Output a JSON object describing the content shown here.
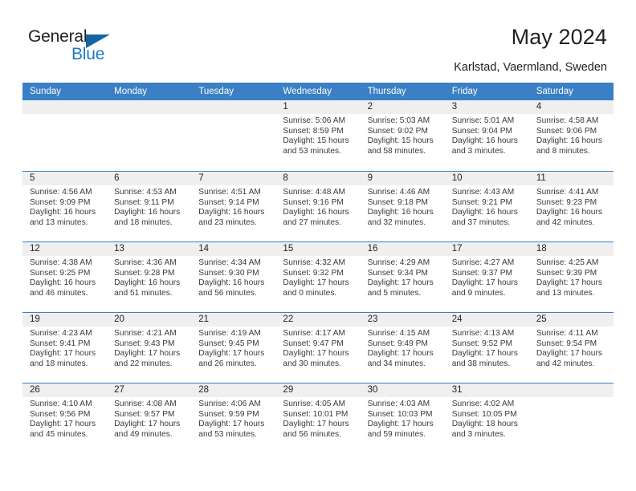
{
  "brand": {
    "name_part1": "General",
    "name_part2": "Blue",
    "accent_color": "#1f7ac0",
    "triangle_color": "#1464a5"
  },
  "header": {
    "title": "May 2024",
    "subtitle": "Karlstad, Vaermland, Sweden"
  },
  "calendar": {
    "header_color": "#3b7fc4",
    "weekdays": [
      "Sunday",
      "Monday",
      "Tuesday",
      "Wednesday",
      "Thursday",
      "Friday",
      "Saturday"
    ],
    "weeks": [
      [
        {
          "empty": true
        },
        {
          "empty": true
        },
        {
          "empty": true
        },
        {
          "day": "1",
          "sunrise": "Sunrise: 5:06 AM",
          "sunset": "Sunset: 8:59 PM",
          "daylight1": "Daylight: 15 hours",
          "daylight2": "and 53 minutes."
        },
        {
          "day": "2",
          "sunrise": "Sunrise: 5:03 AM",
          "sunset": "Sunset: 9:02 PM",
          "daylight1": "Daylight: 15 hours",
          "daylight2": "and 58 minutes."
        },
        {
          "day": "3",
          "sunrise": "Sunrise: 5:01 AM",
          "sunset": "Sunset: 9:04 PM",
          "daylight1": "Daylight: 16 hours",
          "daylight2": "and 3 minutes."
        },
        {
          "day": "4",
          "sunrise": "Sunrise: 4:58 AM",
          "sunset": "Sunset: 9:06 PM",
          "daylight1": "Daylight: 16 hours",
          "daylight2": "and 8 minutes."
        }
      ],
      [
        {
          "day": "5",
          "sunrise": "Sunrise: 4:56 AM",
          "sunset": "Sunset: 9:09 PM",
          "daylight1": "Daylight: 16 hours",
          "daylight2": "and 13 minutes."
        },
        {
          "day": "6",
          "sunrise": "Sunrise: 4:53 AM",
          "sunset": "Sunset: 9:11 PM",
          "daylight1": "Daylight: 16 hours",
          "daylight2": "and 18 minutes."
        },
        {
          "day": "7",
          "sunrise": "Sunrise: 4:51 AM",
          "sunset": "Sunset: 9:14 PM",
          "daylight1": "Daylight: 16 hours",
          "daylight2": "and 23 minutes."
        },
        {
          "day": "8",
          "sunrise": "Sunrise: 4:48 AM",
          "sunset": "Sunset: 9:16 PM",
          "daylight1": "Daylight: 16 hours",
          "daylight2": "and 27 minutes."
        },
        {
          "day": "9",
          "sunrise": "Sunrise: 4:46 AM",
          "sunset": "Sunset: 9:18 PM",
          "daylight1": "Daylight: 16 hours",
          "daylight2": "and 32 minutes."
        },
        {
          "day": "10",
          "sunrise": "Sunrise: 4:43 AM",
          "sunset": "Sunset: 9:21 PM",
          "daylight1": "Daylight: 16 hours",
          "daylight2": "and 37 minutes."
        },
        {
          "day": "11",
          "sunrise": "Sunrise: 4:41 AM",
          "sunset": "Sunset: 9:23 PM",
          "daylight1": "Daylight: 16 hours",
          "daylight2": "and 42 minutes."
        }
      ],
      [
        {
          "day": "12",
          "sunrise": "Sunrise: 4:38 AM",
          "sunset": "Sunset: 9:25 PM",
          "daylight1": "Daylight: 16 hours",
          "daylight2": "and 46 minutes."
        },
        {
          "day": "13",
          "sunrise": "Sunrise: 4:36 AM",
          "sunset": "Sunset: 9:28 PM",
          "daylight1": "Daylight: 16 hours",
          "daylight2": "and 51 minutes."
        },
        {
          "day": "14",
          "sunrise": "Sunrise: 4:34 AM",
          "sunset": "Sunset: 9:30 PM",
          "daylight1": "Daylight: 16 hours",
          "daylight2": "and 56 minutes."
        },
        {
          "day": "15",
          "sunrise": "Sunrise: 4:32 AM",
          "sunset": "Sunset: 9:32 PM",
          "daylight1": "Daylight: 17 hours",
          "daylight2": "and 0 minutes."
        },
        {
          "day": "16",
          "sunrise": "Sunrise: 4:29 AM",
          "sunset": "Sunset: 9:34 PM",
          "daylight1": "Daylight: 17 hours",
          "daylight2": "and 5 minutes."
        },
        {
          "day": "17",
          "sunrise": "Sunrise: 4:27 AM",
          "sunset": "Sunset: 9:37 PM",
          "daylight1": "Daylight: 17 hours",
          "daylight2": "and 9 minutes."
        },
        {
          "day": "18",
          "sunrise": "Sunrise: 4:25 AM",
          "sunset": "Sunset: 9:39 PM",
          "daylight1": "Daylight: 17 hours",
          "daylight2": "and 13 minutes."
        }
      ],
      [
        {
          "day": "19",
          "sunrise": "Sunrise: 4:23 AM",
          "sunset": "Sunset: 9:41 PM",
          "daylight1": "Daylight: 17 hours",
          "daylight2": "and 18 minutes."
        },
        {
          "day": "20",
          "sunrise": "Sunrise: 4:21 AM",
          "sunset": "Sunset: 9:43 PM",
          "daylight1": "Daylight: 17 hours",
          "daylight2": "and 22 minutes."
        },
        {
          "day": "21",
          "sunrise": "Sunrise: 4:19 AM",
          "sunset": "Sunset: 9:45 PM",
          "daylight1": "Daylight: 17 hours",
          "daylight2": "and 26 minutes."
        },
        {
          "day": "22",
          "sunrise": "Sunrise: 4:17 AM",
          "sunset": "Sunset: 9:47 PM",
          "daylight1": "Daylight: 17 hours",
          "daylight2": "and 30 minutes."
        },
        {
          "day": "23",
          "sunrise": "Sunrise: 4:15 AM",
          "sunset": "Sunset: 9:49 PM",
          "daylight1": "Daylight: 17 hours",
          "daylight2": "and 34 minutes."
        },
        {
          "day": "24",
          "sunrise": "Sunrise: 4:13 AM",
          "sunset": "Sunset: 9:52 PM",
          "daylight1": "Daylight: 17 hours",
          "daylight2": "and 38 minutes."
        },
        {
          "day": "25",
          "sunrise": "Sunrise: 4:11 AM",
          "sunset": "Sunset: 9:54 PM",
          "daylight1": "Daylight: 17 hours",
          "daylight2": "and 42 minutes."
        }
      ],
      [
        {
          "day": "26",
          "sunrise": "Sunrise: 4:10 AM",
          "sunset": "Sunset: 9:56 PM",
          "daylight1": "Daylight: 17 hours",
          "daylight2": "and 45 minutes."
        },
        {
          "day": "27",
          "sunrise": "Sunrise: 4:08 AM",
          "sunset": "Sunset: 9:57 PM",
          "daylight1": "Daylight: 17 hours",
          "daylight2": "and 49 minutes."
        },
        {
          "day": "28",
          "sunrise": "Sunrise: 4:06 AM",
          "sunset": "Sunset: 9:59 PM",
          "daylight1": "Daylight: 17 hours",
          "daylight2": "and 53 minutes."
        },
        {
          "day": "29",
          "sunrise": "Sunrise: 4:05 AM",
          "sunset": "Sunset: 10:01 PM",
          "daylight1": "Daylight: 17 hours",
          "daylight2": "and 56 minutes."
        },
        {
          "day": "30",
          "sunrise": "Sunrise: 4:03 AM",
          "sunset": "Sunset: 10:03 PM",
          "daylight1": "Daylight: 17 hours",
          "daylight2": "and 59 minutes."
        },
        {
          "day": "31",
          "sunrise": "Sunrise: 4:02 AM",
          "sunset": "Sunset: 10:05 PM",
          "daylight1": "Daylight: 18 hours",
          "daylight2": "and 3 minutes."
        },
        {
          "empty": true
        }
      ]
    ]
  }
}
